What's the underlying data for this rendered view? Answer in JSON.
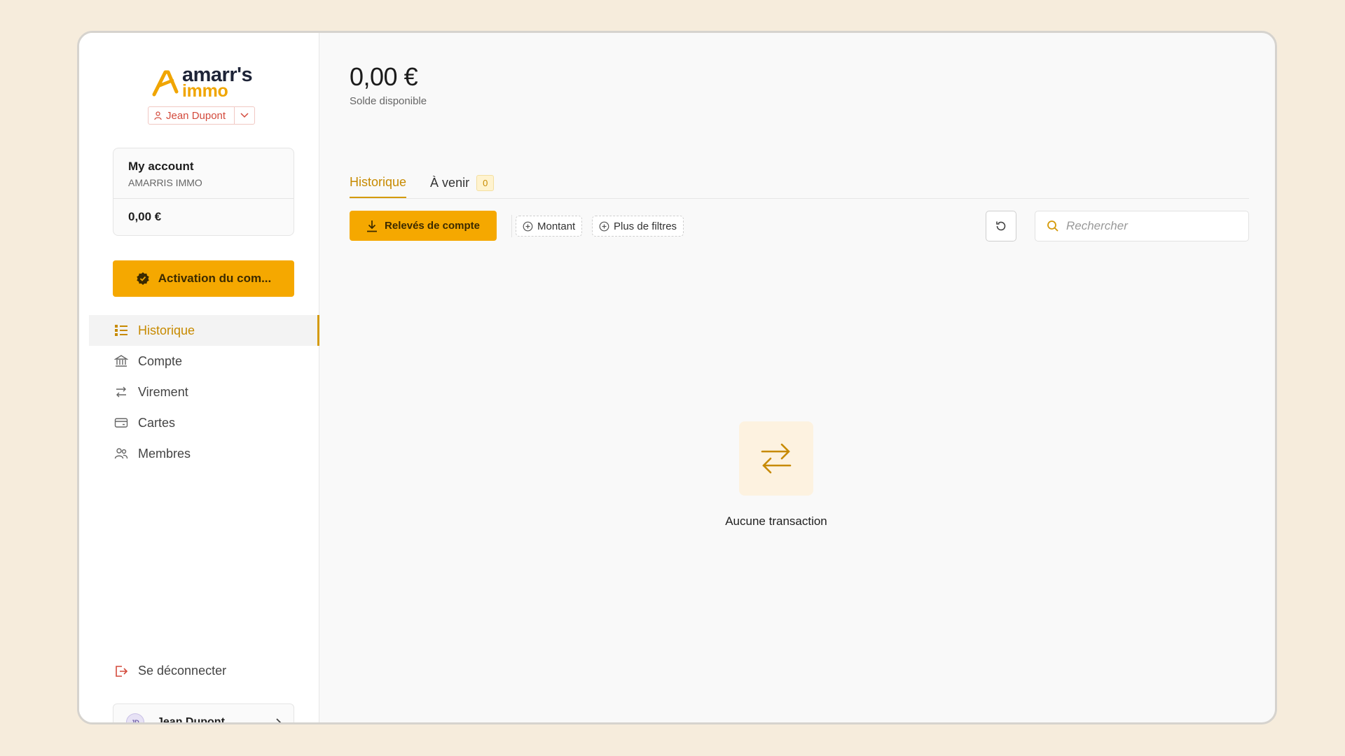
{
  "brand": {
    "name_line1": "amarr's",
    "name_line2": "immo",
    "accent_color": "#f5a800",
    "dark_color": "#1e2437"
  },
  "user_chip": {
    "name": "Jean Dupont",
    "icon": "user-icon",
    "caret_icon": "chevron-down-icon"
  },
  "account_card": {
    "title": "My account",
    "subtitle": "AMARRIS IMMO",
    "balance": "0,00 €"
  },
  "activation_button": {
    "label": "Activation du com...",
    "icon": "verified-badge-icon"
  },
  "nav": {
    "items": [
      {
        "label": "Historique",
        "icon": "list-icon",
        "active": true
      },
      {
        "label": "Compte",
        "icon": "bank-icon",
        "active": false
      },
      {
        "label": "Virement",
        "icon": "transfer-icon",
        "active": false
      },
      {
        "label": "Cartes",
        "icon": "card-icon",
        "active": false
      },
      {
        "label": "Membres",
        "icon": "users-icon",
        "active": false
      }
    ]
  },
  "logout": {
    "label": "Se déconnecter",
    "icon": "logout-icon"
  },
  "profile": {
    "initials": "JD",
    "name": "Jean Dupont",
    "icon": "chevron-right-icon"
  },
  "main": {
    "balance_amount": "0,00 €",
    "balance_label": "Solde disponible",
    "tabs": [
      {
        "label": "Historique",
        "active": true
      },
      {
        "label": "À venir",
        "badge": "0",
        "active": false
      }
    ],
    "toolbar": {
      "statement_button": "Relevés de compte",
      "filter_amount": "Montant",
      "filter_more": "Plus de filtres",
      "refresh_icon": "refresh-icon",
      "search_placeholder": "Rechercher",
      "search_icon": "search-icon"
    },
    "empty_state": {
      "text": "Aucune transaction",
      "icon": "transfer-icon"
    }
  }
}
